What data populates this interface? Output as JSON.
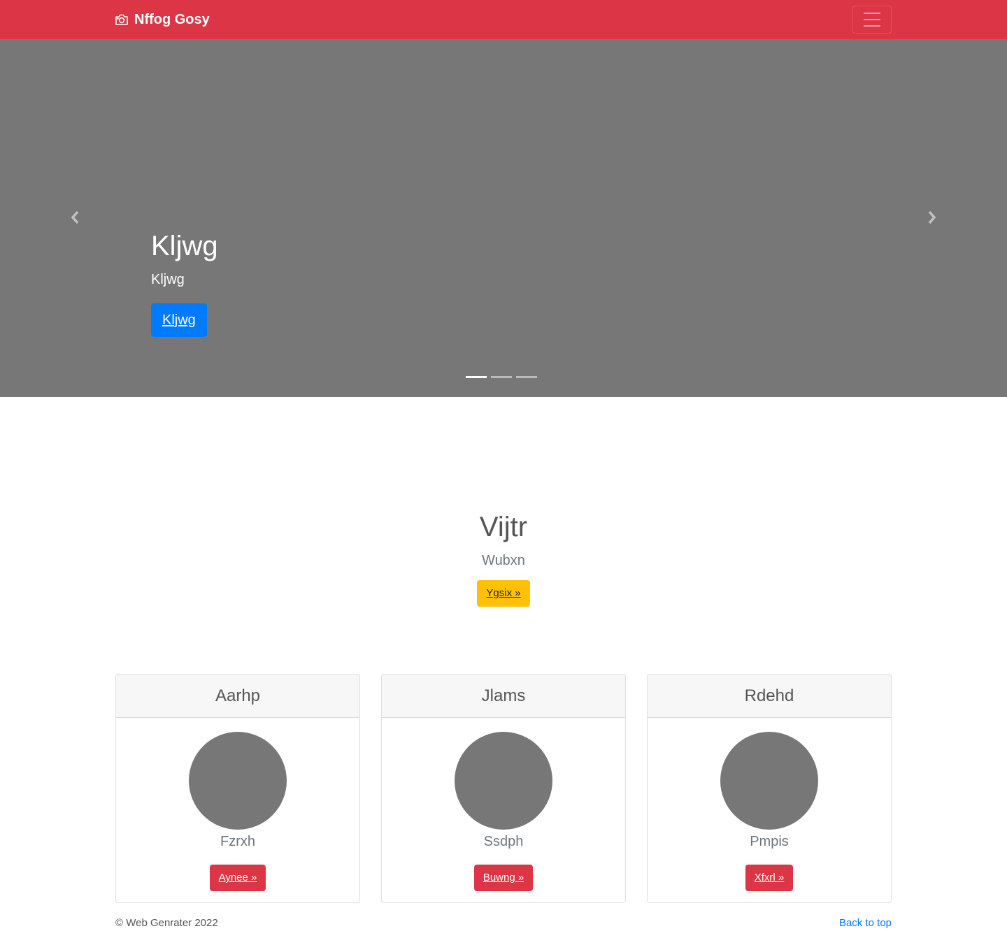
{
  "navbar": {
    "brand": "Nffog Gosy",
    "brand_icon": "camera-icon",
    "toggler_icon": "hamburger-icon"
  },
  "carousel": {
    "slide": {
      "title": "Kljwg",
      "text": "Kljwg",
      "button": "Kljwg"
    },
    "prev_icon": "chevron-left-icon",
    "next_icon": "chevron-right-icon",
    "indicator_count": 3,
    "active_index": 0
  },
  "intro": {
    "title": "Vijtr",
    "subtitle": "Wubxn",
    "button": "Ygsix »"
  },
  "cards": [
    {
      "title": "Aarhp",
      "text": "Fzrxh",
      "button": "Aynee »"
    },
    {
      "title": "Jlams",
      "text": "Ssdph",
      "button": "Buwng »"
    },
    {
      "title": "Rdehd",
      "text": "Pmpis",
      "button": "Xfxrl »"
    }
  ],
  "footer": {
    "copyright": "© Web Genrater 2022",
    "back_to_top": "Back to top"
  },
  "colors": {
    "navbar": "#dc3545",
    "carousel_bg": "#777777",
    "primary": "#007bff",
    "warning": "#ffc107",
    "danger": "#dc3545"
  }
}
